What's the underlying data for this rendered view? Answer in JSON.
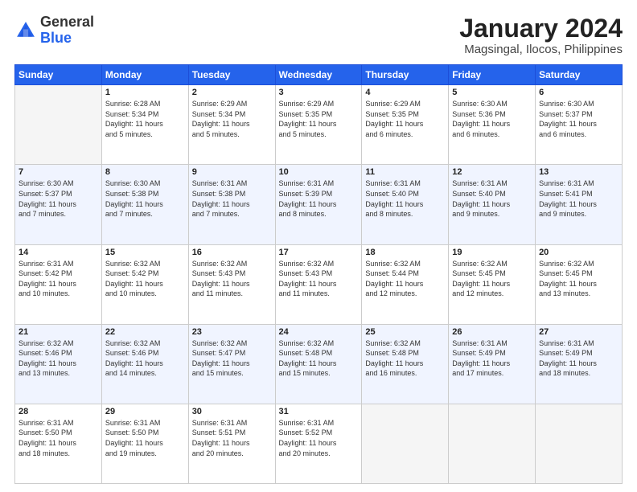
{
  "header": {
    "logo_general": "General",
    "logo_blue": "Blue",
    "month_title": "January 2024",
    "location": "Magsingal, Ilocos, Philippines"
  },
  "weekdays": [
    "Sunday",
    "Monday",
    "Tuesday",
    "Wednesday",
    "Thursday",
    "Friday",
    "Saturday"
  ],
  "weeks": [
    [
      {
        "day": "",
        "info": ""
      },
      {
        "day": "1",
        "info": "Sunrise: 6:28 AM\nSunset: 5:34 PM\nDaylight: 11 hours\nand 5 minutes."
      },
      {
        "day": "2",
        "info": "Sunrise: 6:29 AM\nSunset: 5:34 PM\nDaylight: 11 hours\nand 5 minutes."
      },
      {
        "day": "3",
        "info": "Sunrise: 6:29 AM\nSunset: 5:35 PM\nDaylight: 11 hours\nand 5 minutes."
      },
      {
        "day": "4",
        "info": "Sunrise: 6:29 AM\nSunset: 5:35 PM\nDaylight: 11 hours\nand 6 minutes."
      },
      {
        "day": "5",
        "info": "Sunrise: 6:30 AM\nSunset: 5:36 PM\nDaylight: 11 hours\nand 6 minutes."
      },
      {
        "day": "6",
        "info": "Sunrise: 6:30 AM\nSunset: 5:37 PM\nDaylight: 11 hours\nand 6 minutes."
      }
    ],
    [
      {
        "day": "7",
        "info": "Sunrise: 6:30 AM\nSunset: 5:37 PM\nDaylight: 11 hours\nand 7 minutes."
      },
      {
        "day": "8",
        "info": "Sunrise: 6:30 AM\nSunset: 5:38 PM\nDaylight: 11 hours\nand 7 minutes."
      },
      {
        "day": "9",
        "info": "Sunrise: 6:31 AM\nSunset: 5:38 PM\nDaylight: 11 hours\nand 7 minutes."
      },
      {
        "day": "10",
        "info": "Sunrise: 6:31 AM\nSunset: 5:39 PM\nDaylight: 11 hours\nand 8 minutes."
      },
      {
        "day": "11",
        "info": "Sunrise: 6:31 AM\nSunset: 5:40 PM\nDaylight: 11 hours\nand 8 minutes."
      },
      {
        "day": "12",
        "info": "Sunrise: 6:31 AM\nSunset: 5:40 PM\nDaylight: 11 hours\nand 9 minutes."
      },
      {
        "day": "13",
        "info": "Sunrise: 6:31 AM\nSunset: 5:41 PM\nDaylight: 11 hours\nand 9 minutes."
      }
    ],
    [
      {
        "day": "14",
        "info": "Sunrise: 6:31 AM\nSunset: 5:42 PM\nDaylight: 11 hours\nand 10 minutes."
      },
      {
        "day": "15",
        "info": "Sunrise: 6:32 AM\nSunset: 5:42 PM\nDaylight: 11 hours\nand 10 minutes."
      },
      {
        "day": "16",
        "info": "Sunrise: 6:32 AM\nSunset: 5:43 PM\nDaylight: 11 hours\nand 11 minutes."
      },
      {
        "day": "17",
        "info": "Sunrise: 6:32 AM\nSunset: 5:43 PM\nDaylight: 11 hours\nand 11 minutes."
      },
      {
        "day": "18",
        "info": "Sunrise: 6:32 AM\nSunset: 5:44 PM\nDaylight: 11 hours\nand 12 minutes."
      },
      {
        "day": "19",
        "info": "Sunrise: 6:32 AM\nSunset: 5:45 PM\nDaylight: 11 hours\nand 12 minutes."
      },
      {
        "day": "20",
        "info": "Sunrise: 6:32 AM\nSunset: 5:45 PM\nDaylight: 11 hours\nand 13 minutes."
      }
    ],
    [
      {
        "day": "21",
        "info": "Sunrise: 6:32 AM\nSunset: 5:46 PM\nDaylight: 11 hours\nand 13 minutes."
      },
      {
        "day": "22",
        "info": "Sunrise: 6:32 AM\nSunset: 5:46 PM\nDaylight: 11 hours\nand 14 minutes."
      },
      {
        "day": "23",
        "info": "Sunrise: 6:32 AM\nSunset: 5:47 PM\nDaylight: 11 hours\nand 15 minutes."
      },
      {
        "day": "24",
        "info": "Sunrise: 6:32 AM\nSunset: 5:48 PM\nDaylight: 11 hours\nand 15 minutes."
      },
      {
        "day": "25",
        "info": "Sunrise: 6:32 AM\nSunset: 5:48 PM\nDaylight: 11 hours\nand 16 minutes."
      },
      {
        "day": "26",
        "info": "Sunrise: 6:31 AM\nSunset: 5:49 PM\nDaylight: 11 hours\nand 17 minutes."
      },
      {
        "day": "27",
        "info": "Sunrise: 6:31 AM\nSunset: 5:49 PM\nDaylight: 11 hours\nand 18 minutes."
      }
    ],
    [
      {
        "day": "28",
        "info": "Sunrise: 6:31 AM\nSunset: 5:50 PM\nDaylight: 11 hours\nand 18 minutes."
      },
      {
        "day": "29",
        "info": "Sunrise: 6:31 AM\nSunset: 5:50 PM\nDaylight: 11 hours\nand 19 minutes."
      },
      {
        "day": "30",
        "info": "Sunrise: 6:31 AM\nSunset: 5:51 PM\nDaylight: 11 hours\nand 20 minutes."
      },
      {
        "day": "31",
        "info": "Sunrise: 6:31 AM\nSunset: 5:52 PM\nDaylight: 11 hours\nand 20 minutes."
      },
      {
        "day": "",
        "info": ""
      },
      {
        "day": "",
        "info": ""
      },
      {
        "day": "",
        "info": ""
      }
    ]
  ]
}
